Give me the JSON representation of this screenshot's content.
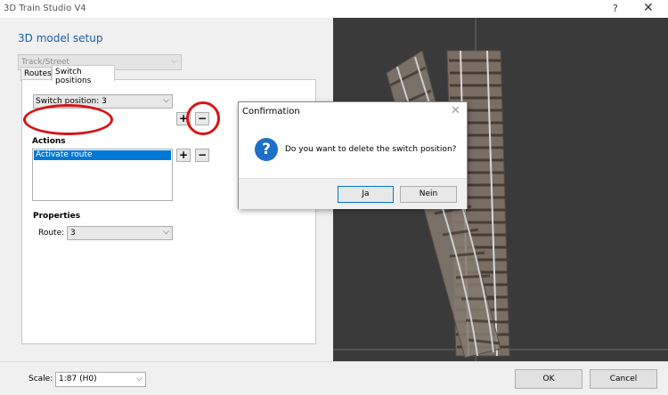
{
  "window": {
    "title": "3D Train Studio V4",
    "help_glyph": "?",
    "close_glyph": "✕"
  },
  "setup": {
    "title": "3D model setup",
    "model_type": "Track/Street",
    "tabs": [
      {
        "label": "Routes"
      },
      {
        "label": "Switch positions"
      }
    ],
    "switch_position": {
      "value": "Switch position: 3",
      "add_glyph": "+",
      "remove_glyph": "−"
    },
    "actions": {
      "label": "Actions",
      "items": [
        "Activate route"
      ],
      "add_glyph": "+",
      "remove_glyph": "−"
    },
    "properties": {
      "label": "Properties",
      "route_label": "Route:",
      "route_value": "3"
    },
    "dropdown_glyph": "⌵"
  },
  "dialog": {
    "title": "Confirmation",
    "close_glyph": "✕",
    "icon_glyph": "?",
    "message": "Do you want to delete the switch position?",
    "yes_label": "Ja",
    "no_label": "Nein"
  },
  "footer": {
    "scale_label": "Scale:",
    "scale_value": "1:87 (H0)",
    "ok_label": "OK",
    "cancel_label": "Cancel"
  },
  "colors": {
    "annotation_red": "#d51518",
    "accent_blue": "#1a5ea8",
    "selection_blue": "#0078d7",
    "viewport_bg": "#3a3a3a"
  }
}
